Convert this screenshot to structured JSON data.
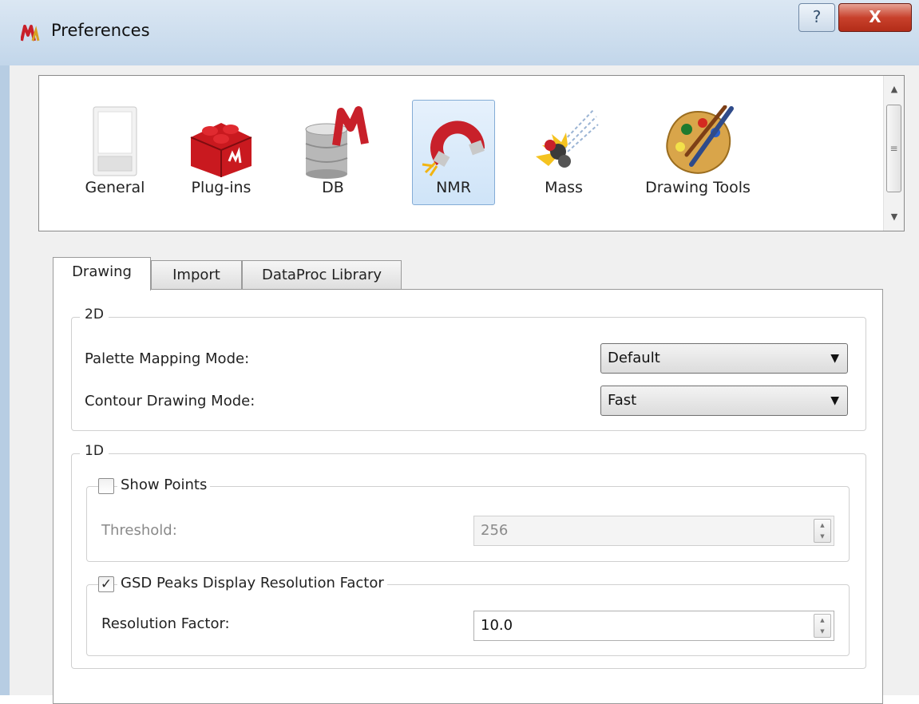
{
  "window": {
    "title": "Preferences",
    "help_glyph": "?",
    "close_glyph": "X"
  },
  "categories": [
    {
      "label": "General",
      "icon": "general-icon"
    },
    {
      "label": "Plug-ins",
      "icon": "plugins-icon"
    },
    {
      "label": "DB",
      "icon": "db-icon"
    },
    {
      "label": "NMR",
      "icon": "nmr-magnet-icon",
      "selected": true
    },
    {
      "label": "Mass",
      "icon": "mass-icon"
    },
    {
      "label": "Drawing Tools",
      "icon": "palette-icon"
    }
  ],
  "tabs": [
    {
      "label": "Drawing",
      "active": true
    },
    {
      "label": "Import"
    },
    {
      "label": "DataProc Library"
    }
  ],
  "group_2d": {
    "title": "2D",
    "palette_label": "Palette Mapping Mode:",
    "palette_value": "Default",
    "contour_label": "Contour Drawing Mode:",
    "contour_value": "Fast"
  },
  "group_1d": {
    "title": "1D",
    "show_points": {
      "label": "Show Points",
      "checked": false,
      "threshold_label": "Threshold:",
      "threshold_value": "256"
    },
    "gsd": {
      "label": "GSD Peaks Display Resolution Factor",
      "checked": true,
      "checkmark": "✓",
      "resolution_label": "Resolution Factor:",
      "resolution_value": "10.0"
    }
  },
  "colors": {
    "accent_selected": "#cfe4f8",
    "close_red": "#c8412c",
    "title_bar": "#c2d6ea"
  }
}
